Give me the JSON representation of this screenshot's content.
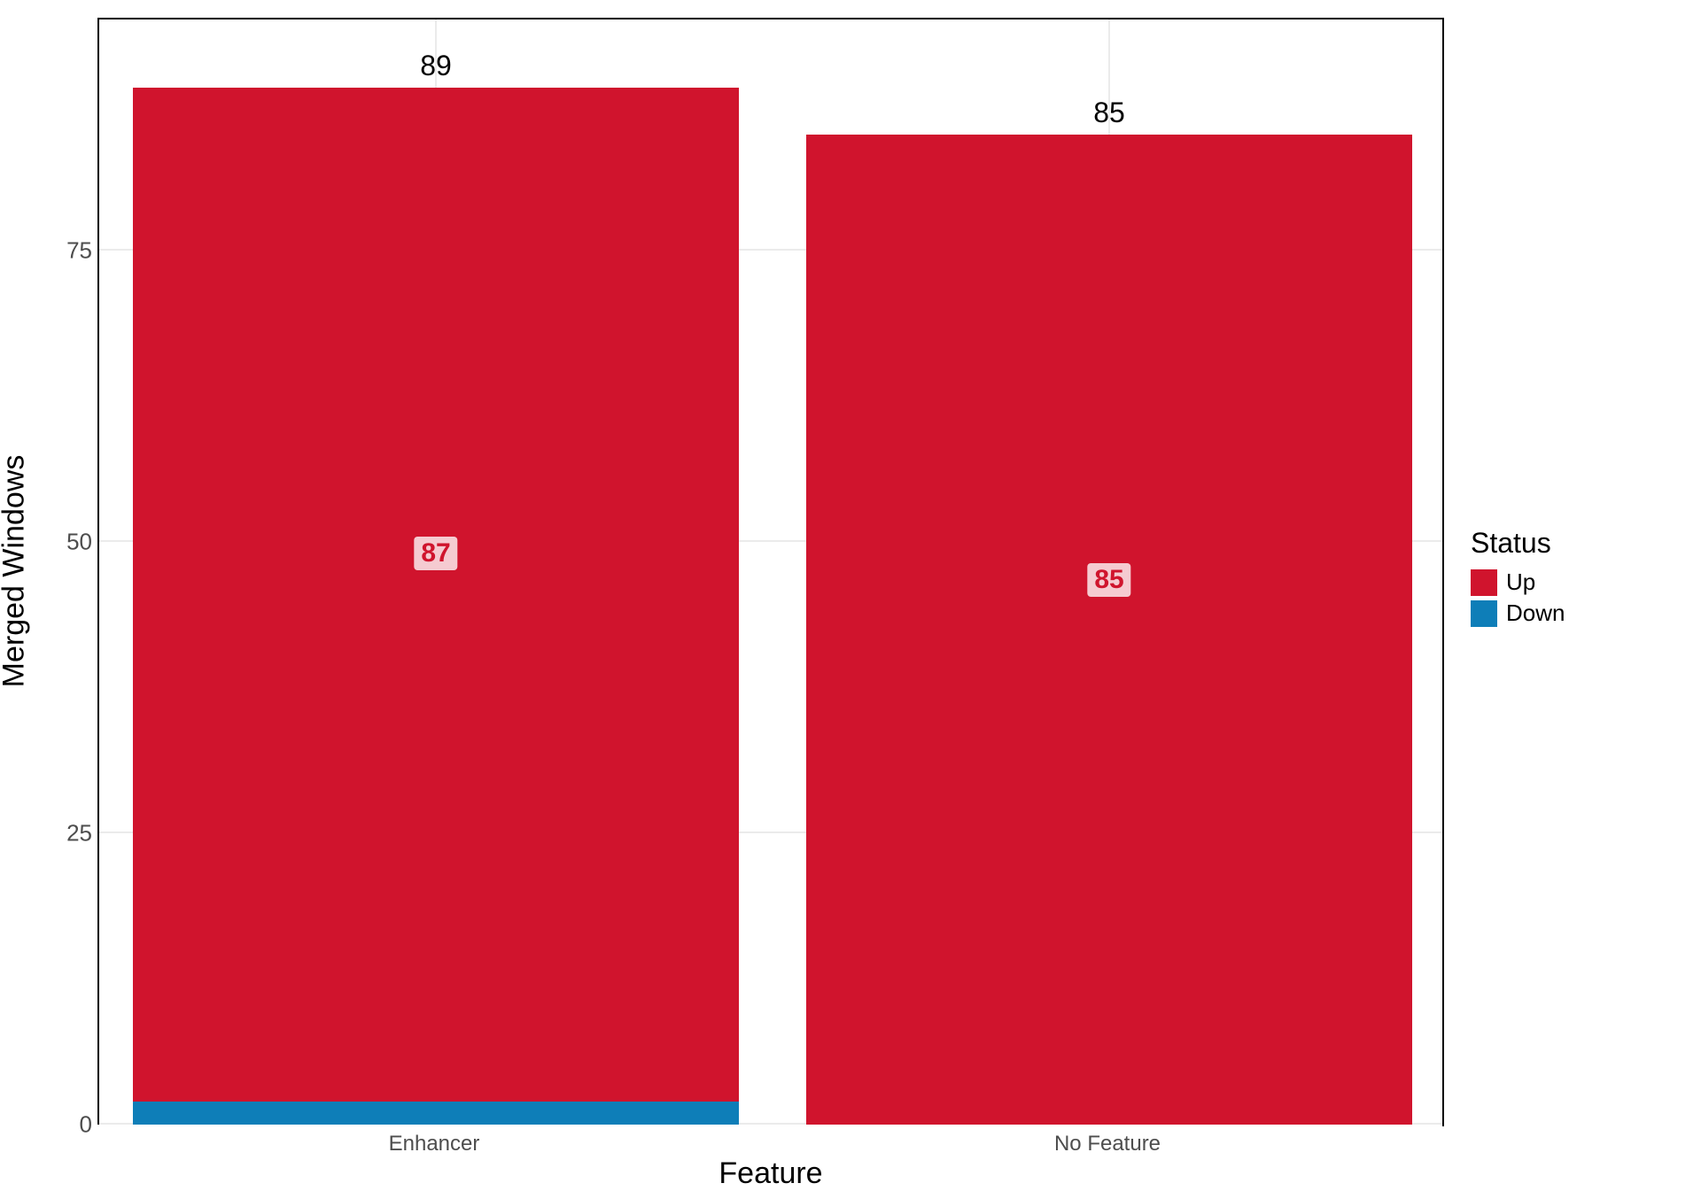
{
  "chart_data": {
    "type": "bar",
    "stacked": true,
    "xlabel": "Feature",
    "ylabel": "Merged Windows",
    "ylim": [
      0,
      95
    ],
    "y_ticks": [
      0,
      25,
      50,
      75
    ],
    "categories": [
      "Enhancer",
      "No Feature"
    ],
    "series": [
      {
        "name": "Down",
        "color": "#0e7eb8",
        "values": [
          2,
          0
        ]
      },
      {
        "name": "Up",
        "color": "#d0142d",
        "values": [
          87,
          85
        ]
      }
    ],
    "totals": [
      89,
      85
    ],
    "legend": {
      "title": "Status",
      "order": [
        "Up",
        "Down"
      ]
    }
  },
  "colors": {
    "up": "#d0142d",
    "down": "#0e7eb8"
  }
}
